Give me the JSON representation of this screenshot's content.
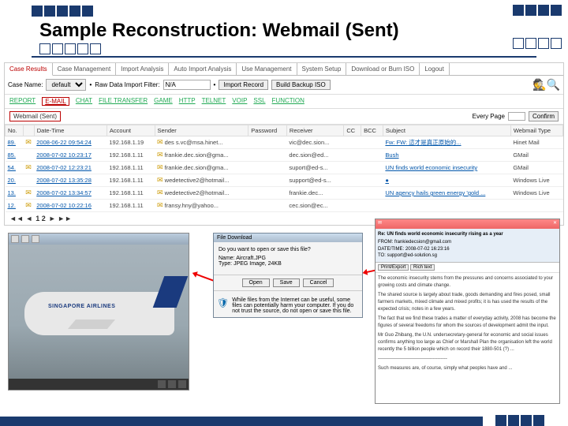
{
  "slide_title": "Sample Reconstruction: Webmail (Sent)",
  "main_tabs": [
    "Case Results",
    "Case Management",
    "Import Analysis",
    "Auto Import Analysis",
    "Use Management",
    "System Setup",
    "Download or Burn ISO",
    "Logout"
  ],
  "filter": {
    "case_label": "Case Name:",
    "case_value": "default",
    "raw_label": "Raw Data Import Filter:",
    "raw_value": "N/A",
    "import_record": "Import Record",
    "build_iso": "Build Backup ISO"
  },
  "protocols": {
    "items": [
      "REPORT",
      "E-MAIL",
      "CHAT",
      "FILE TRANSFER",
      "GAME",
      "HTTP",
      "TELNET",
      "VOIP",
      "SSL",
      "FUNCTION"
    ],
    "active": "E-MAIL"
  },
  "folder_label": "Webmail (Sent)",
  "page": {
    "every_label": "Every Page",
    "value": "",
    "confirm": "Confirm"
  },
  "columns": [
    "No.",
    "",
    "Date-Time",
    "Account",
    "Sender",
    "Password",
    "Receiver",
    "CC",
    "BCC",
    "Subject",
    "Webmail Type"
  ],
  "rows": [
    {
      "no": "89.",
      "att": "✉",
      "dt": "2008-06-22 09:54:24",
      "acct": "192.168.1.19",
      "sender": "des s.vc@msa.hinet...",
      "pw": "",
      "rcv": "vic@dec.sion...",
      "cc": "",
      "bcc": "",
      "subj": "Fw: FW: 這才是真正原始的...",
      "type": "Hinet Mail"
    },
    {
      "no": "85.",
      "att": "",
      "dt": "2008-07-02 10:23:17",
      "acct": "192.168.1.11",
      "sender": "frankie.dec.sion@gma...",
      "pw": "",
      "rcv": "dec.sion@ed...",
      "cc": "",
      "bcc": "",
      "subj": "Bush",
      "type": "GMail"
    },
    {
      "no": "54.",
      "att": "✉",
      "dt": "2008-07-02 12:23:21",
      "acct": "192.168.1.11",
      "sender": "frankie.dec.sion@gma...",
      "pw": "",
      "rcv": "suport@ed-s...",
      "cc": "",
      "bcc": "",
      "subj": "UN finds world economic insecurity",
      "type": "GMail"
    },
    {
      "no": "20.",
      "att": "",
      "dt": "2008-07-02 13:35:28",
      "acct": "192.168.1.11",
      "sender": "wedetective2@hotmail...",
      "pw": "",
      "rcv": "support@ed-s...",
      "cc": "",
      "bcc": "",
      "subj": "●",
      "type": "Windows Live"
    },
    {
      "no": "13.",
      "att": "✉",
      "dt": "2008-07-02 13:34:57",
      "acct": "192.168.1.11",
      "sender": "wedetective2@hotmail...",
      "pw": "",
      "rcv": "frankie.dec...",
      "cc": "",
      "bcc": "",
      "subj": "UN agency hails green energy 'gold ...",
      "type": "Windows Live"
    },
    {
      "no": "12.",
      "att": "✉",
      "dt": "2008-07-02 10:22:16",
      "acct": "192.168.1.11",
      "sender": "fransy.hny@yahoo...",
      "pw": "",
      "rcv": "cec.sion@ec...",
      "cc": "",
      "bcc": "",
      "subj": "",
      "type": ""
    }
  ],
  "paginator": {
    "prev": "◄◄ ◄",
    "pages": "1 2",
    "next": "► ►►",
    "total": "2"
  },
  "image": {
    "text": "SINGAPORE AIRLINES"
  },
  "save_dialog": {
    "title": "File Download",
    "prompt": "Do you want to open or save this file?",
    "name": "Name:",
    "name_val": "Aircraft.JPG",
    "type": "Type:",
    "type_val": "JPEG Image, 24KB",
    "buttons": [
      "Open",
      "Save",
      "Cancel"
    ],
    "warn": "While files from the Internet can be useful, some files can potentially harm your computer. If you do not trust the source, do not open or save this file."
  },
  "email": {
    "subj_line": "Re: UN finds world economic insecurity rising as a year",
    "from_label": "FROM:",
    "from": "frankiedecsion@gmail.com",
    "date_label": "DATE/TIME:",
    "date": "2008-07-02 16:23:16",
    "to_label": "TO:",
    "to": "support@ed-solution.sg",
    "attach_btns": [
      "Print/Export",
      "Rich text"
    ],
    "body": [
      "The economic insecurity stems from the pressures and concerns associated to your growing costs and climate change.",
      "The shared source is largely about trade, goods demanding and fires posed, small farmers markets, mixed climate and mixed profits; it is has used the results of the expected crisis; notes in a few years.",
      "The fact that we find these trades a matter of everyday activity, 2008 has become the figures of several freedoms for whom the sources of development admit the input.",
      "Mr Guo Zhibang, the U.N. undersecretary-general for economic and social issues confirms anything too large as Chief or Marshall Plan the organisation left the world recently the 5 billion people which on record their 1880-501 (?) ...",
      "--------------------------------------------",
      "Such measures are, of course, simply what peoples have and ..."
    ]
  }
}
